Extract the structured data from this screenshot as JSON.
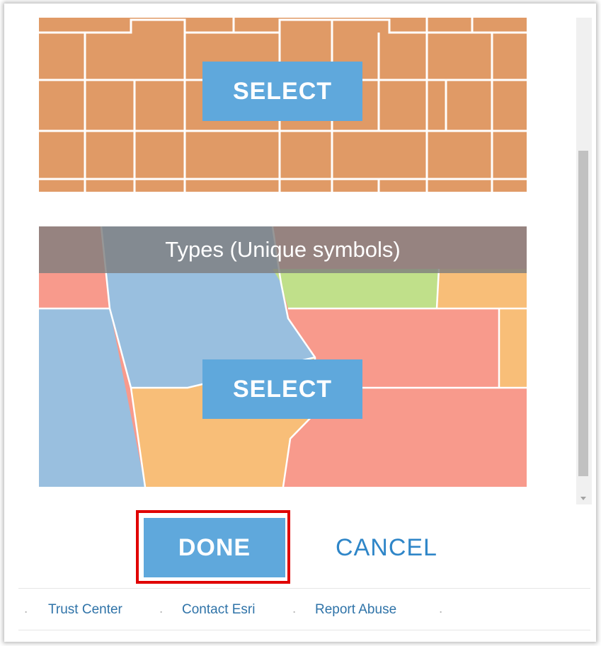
{
  "dialog": {
    "options": [
      {
        "title": "",
        "select_label": "SELECT",
        "map_fill": "#e09a66",
        "map_line": "#ffffff"
      },
      {
        "title": "Types (Unique symbols)",
        "select_label": "SELECT",
        "map_colors": {
          "blue": "#99bfdf",
          "orange": "#f8be78",
          "red": "#f89a8c",
          "green": "#c0e08a"
        }
      }
    ],
    "done_label": "DONE",
    "cancel_label": "CANCEL",
    "accent_color": "#5fa8dc",
    "highlight_color": "#e00000"
  },
  "footer": {
    "links": [
      {
        "label": "Trust Center"
      },
      {
        "label": "Contact Esri"
      },
      {
        "label": "Report Abuse"
      }
    ],
    "separator": "."
  }
}
